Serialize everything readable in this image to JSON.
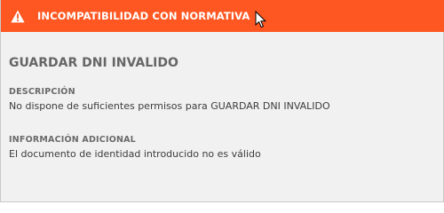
{
  "dialog": {
    "title": "INCOMPATIBILIDAD CON NORMATIVA",
    "accent_color": "#ff5722",
    "icon": "warning-icon"
  },
  "content": {
    "heading": "GUARDAR DNI INVALIDO",
    "description_label": "DESCRIPCIÓN",
    "description_value": "No dispone de suficientes permisos para GUARDAR DNI INVALIDO",
    "additional_label": "INFORMACIÓN ADICIONAL",
    "additional_value": "El documento de identidad introducido no es válido"
  }
}
